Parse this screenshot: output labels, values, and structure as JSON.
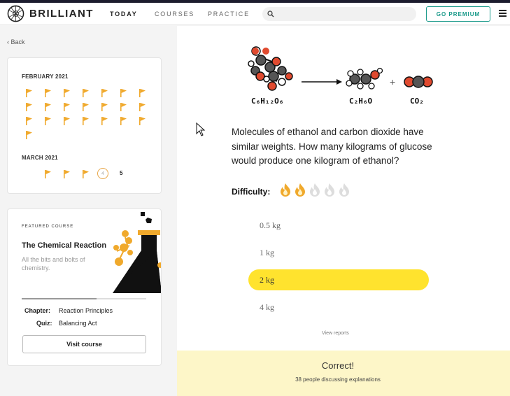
{
  "header": {
    "brand": "BRILLIANT",
    "nav": [
      "TODAY",
      "COURSES",
      "PRACTICE"
    ],
    "premium_label": "GO PREMIUM",
    "search_icon": "search-icon",
    "menu_icon": "hamburger-menu-icon"
  },
  "sidebar": {
    "back_label": "Back",
    "calendar": {
      "month1": "FEBRUARY 2021",
      "month1_flag_count": 22,
      "month2": "MARCH 2021",
      "month2_flag_count": 3,
      "today_day": "4",
      "next_day": "5",
      "flag_color": "#f0a92c"
    },
    "course": {
      "featured_label": "FEATURED COURSE",
      "title": "The Chemical Reaction",
      "description": "All the bits and bolts of chemistry.",
      "chapter_label": "Chapter:",
      "chapter_value": "Reaction Principles",
      "quiz_label": "Quiz:",
      "quiz_value": "Balancing Act",
      "visit_label": "Visit course",
      "progress_fraction": 0.6
    }
  },
  "problem": {
    "formulas": {
      "glucose": "C₆H₁₂O₆",
      "ethanol": "C₂H₆O",
      "plus": "+",
      "co2": "CO₂"
    },
    "question": "Molecules of ethanol and carbon dioxide have similar weights. How many kilograms of glucose would produce one kilogram of ethanol?",
    "difficulty_label": "Difficulty:",
    "difficulty_level": 2,
    "difficulty_max": 5,
    "options": [
      "0.5 kg",
      "1 kg",
      "2 kg",
      "4 kg"
    ],
    "selected_index": 2,
    "view_reports": "View reports",
    "feedback_title": "Correct!",
    "feedback_sub": "38 people discussing explanations",
    "accent_color": "#ffe32e"
  }
}
